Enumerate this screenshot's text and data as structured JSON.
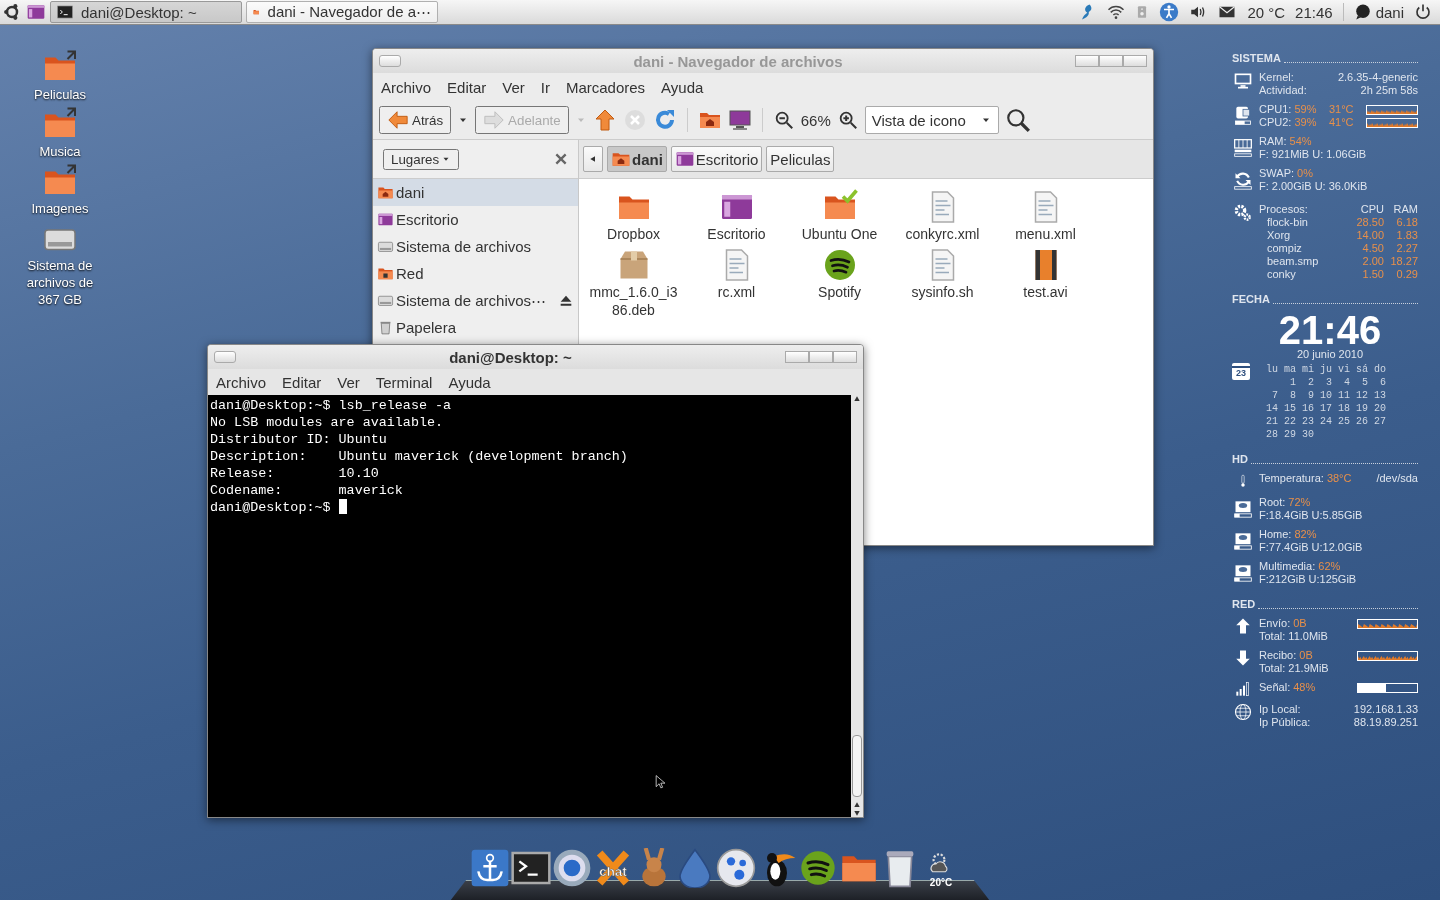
{
  "top_panel": {
    "tasks": [
      {
        "label": "dani@Desktop: ~",
        "kind": "terminal",
        "selected": true
      },
      {
        "label": "dani - Navegador de a⋯",
        "kind": "files",
        "selected": false
      }
    ],
    "temperature": "20 °C",
    "clock": "21:46",
    "user": "dani"
  },
  "desktop_icons": [
    {
      "label": "Peliculas",
      "kind": "folder"
    },
    {
      "label": "Musica",
      "kind": "folder"
    },
    {
      "label": "Imagenes",
      "kind": "folder"
    },
    {
      "label": "Sistema de archivos de 367 GB",
      "kind": "drive"
    }
  ],
  "file_manager": {
    "title": "dani - Navegador de archivos",
    "menu": [
      "Archivo",
      "Editar",
      "Ver",
      "Ir",
      "Marcadores",
      "Ayuda"
    ],
    "back": "Atrás",
    "forward": {
      "label": "Adelante",
      "disabled": true
    },
    "zoom": "66%",
    "view": "Vista de icono",
    "places_label": "Lugares",
    "places": [
      {
        "label": "dani",
        "kind": "home",
        "selected": true,
        "ejectable": false
      },
      {
        "label": "Escritorio",
        "kind": "desktop",
        "selected": false,
        "ejectable": false
      },
      {
        "label": "Sistema de archivos",
        "kind": "drive",
        "selected": false,
        "ejectable": false
      },
      {
        "label": "Red",
        "kind": "network",
        "selected": false,
        "ejectable": false
      },
      {
        "label": "Sistema de archivos⋯",
        "kind": "drive",
        "selected": false,
        "ejectable": true
      },
      {
        "label": "Papelera",
        "kind": "trash",
        "selected": false,
        "ejectable": false
      }
    ],
    "path": [
      {
        "label": "dani",
        "kind": "home",
        "selected": true
      },
      {
        "label": "Escritorio",
        "kind": "desktop",
        "selected": false
      },
      {
        "label": "Peliculas",
        "kind": "plain",
        "selected": false
      }
    ],
    "files": [
      {
        "name": "Dropbox",
        "kind": "folder"
      },
      {
        "name": "Escritorio",
        "kind": "desktop"
      },
      {
        "name": "Ubuntu One",
        "kind": "synced"
      },
      {
        "name": "conkyrc.xml",
        "kind": "text"
      },
      {
        "name": "menu.xml",
        "kind": "text"
      },
      {
        "name": "mmc_1.6.0_i386.deb",
        "kind": "package"
      },
      {
        "name": "rc.xml",
        "kind": "text"
      },
      {
        "name": "Spotify",
        "kind": "audio"
      },
      {
        "name": "sysinfo.sh",
        "kind": "text"
      },
      {
        "name": "test.avi",
        "kind": "video"
      }
    ]
  },
  "terminal": {
    "title": "dani@Desktop: ~",
    "menu": [
      "Archivo",
      "Editar",
      "Ver",
      "Terminal",
      "Ayuda"
    ],
    "lines": [
      "dani@Desktop:~$ lsb_release -a",
      "No LSB modules are available.",
      "Distributor ID:\tUbuntu",
      "Description:\tUbuntu maverick (development branch)",
      "Release:\t10.10",
      "Codename:\tmaverick"
    ],
    "prompt": "dani@Desktop:~$ "
  },
  "conky": {
    "sistema": {
      "heading": "SISTEMA",
      "kernel_label": "Kernel:",
      "kernel": "2.6.35-4-generic",
      "uptime_label": "Actividad:",
      "uptime": "2h 25m 58s",
      "cpus": [
        {
          "label": "CPU1:",
          "usage": "59%",
          "temp": "31°C"
        },
        {
          "label": "CPU2:",
          "usage": "39%",
          "temp": "41°C"
        }
      ],
      "ram": {
        "label": "RAM:",
        "usage": "54%",
        "detail": "F: 921MiB U: 1.06GiB"
      },
      "swap": {
        "label": "SWAP:",
        "usage": "0%",
        "detail": "F: 2.00GiB U: 36.0KiB"
      },
      "processes": {
        "label": "Procesos:",
        "columns": [
          "CPU",
          "RAM"
        ],
        "rows": [
          {
            "name": "flock-bin",
            "cpu": "28.50",
            "ram": "6.18"
          },
          {
            "name": "Xorg",
            "cpu": "14.00",
            "ram": "1.83"
          },
          {
            "name": "compiz",
            "cpu": "4.50",
            "ram": "2.27"
          },
          {
            "name": "beam.smp",
            "cpu": "2.00",
            "ram": "18.27"
          },
          {
            "name": "conky",
            "cpu": "1.50",
            "ram": "0.29"
          }
        ]
      }
    },
    "fecha": {
      "heading": "FECHA",
      "time": "21:46",
      "date": "20 junio 2010",
      "icon_day": "23",
      "weekdays": [
        "lu",
        "ma",
        "mi",
        "ju",
        "vi",
        "sá",
        "do"
      ],
      "weeks": [
        {
          "days": [
            "1",
            "2",
            "3",
            "4",
            "5",
            "6"
          ]
        },
        {
          "days": [
            "7",
            "8",
            "9",
            "10",
            "11",
            "12",
            "13"
          ]
        },
        {
          "days": [
            "14",
            "15",
            "16",
            "17",
            "18",
            "19",
            "20"
          ]
        },
        {
          "days": [
            "21",
            "22",
            "23",
            "24",
            "25",
            "26",
            "27"
          ]
        },
        {
          "days": [
            "28",
            "29",
            "30"
          ]
        }
      ]
    },
    "hd": {
      "heading": "HD",
      "temp_label": "Temperatura:",
      "temp": "38°C",
      "device": "/dev/sda",
      "disks": [
        {
          "label": "Root:",
          "usage": "72%",
          "detail": "F:18.4GiB U:5.85GiB"
        },
        {
          "label": "Home:",
          "usage": "82%",
          "detail": "F:77.4GiB U:12.0GiB"
        },
        {
          "label": "Multimedia:",
          "usage": "62%",
          "detail": "F:212GiB U:125GiB"
        }
      ]
    },
    "red": {
      "heading": "RED",
      "up": {
        "label": "Envío:",
        "rate": "0B",
        "total": "Total: 11.0MiB"
      },
      "down": {
        "label": "Recibo:",
        "rate": "0B",
        "total": "Total: 21.9MiB"
      },
      "signal": {
        "label": "Señal:",
        "value": "48%",
        "level": 0.48
      },
      "ip_local_label": "Ip Local:",
      "ip_local": "192.168.1.33",
      "ip_public_label": "Ip Pública:",
      "ip_public": "88.19.89.251"
    }
  },
  "dock": {
    "items": [
      {
        "kind": "anchor"
      },
      {
        "kind": "terminal"
      },
      {
        "kind": "browser"
      },
      {
        "kind": "chat",
        "label": "chat"
      },
      {
        "kind": "rabbit"
      },
      {
        "kind": "drop"
      },
      {
        "kind": "disc"
      },
      {
        "kind": "toucan"
      },
      {
        "kind": "audio"
      },
      {
        "kind": "folder"
      },
      {
        "kind": "trash"
      },
      {
        "kind": "weather",
        "label": "20°C"
      }
    ]
  }
}
